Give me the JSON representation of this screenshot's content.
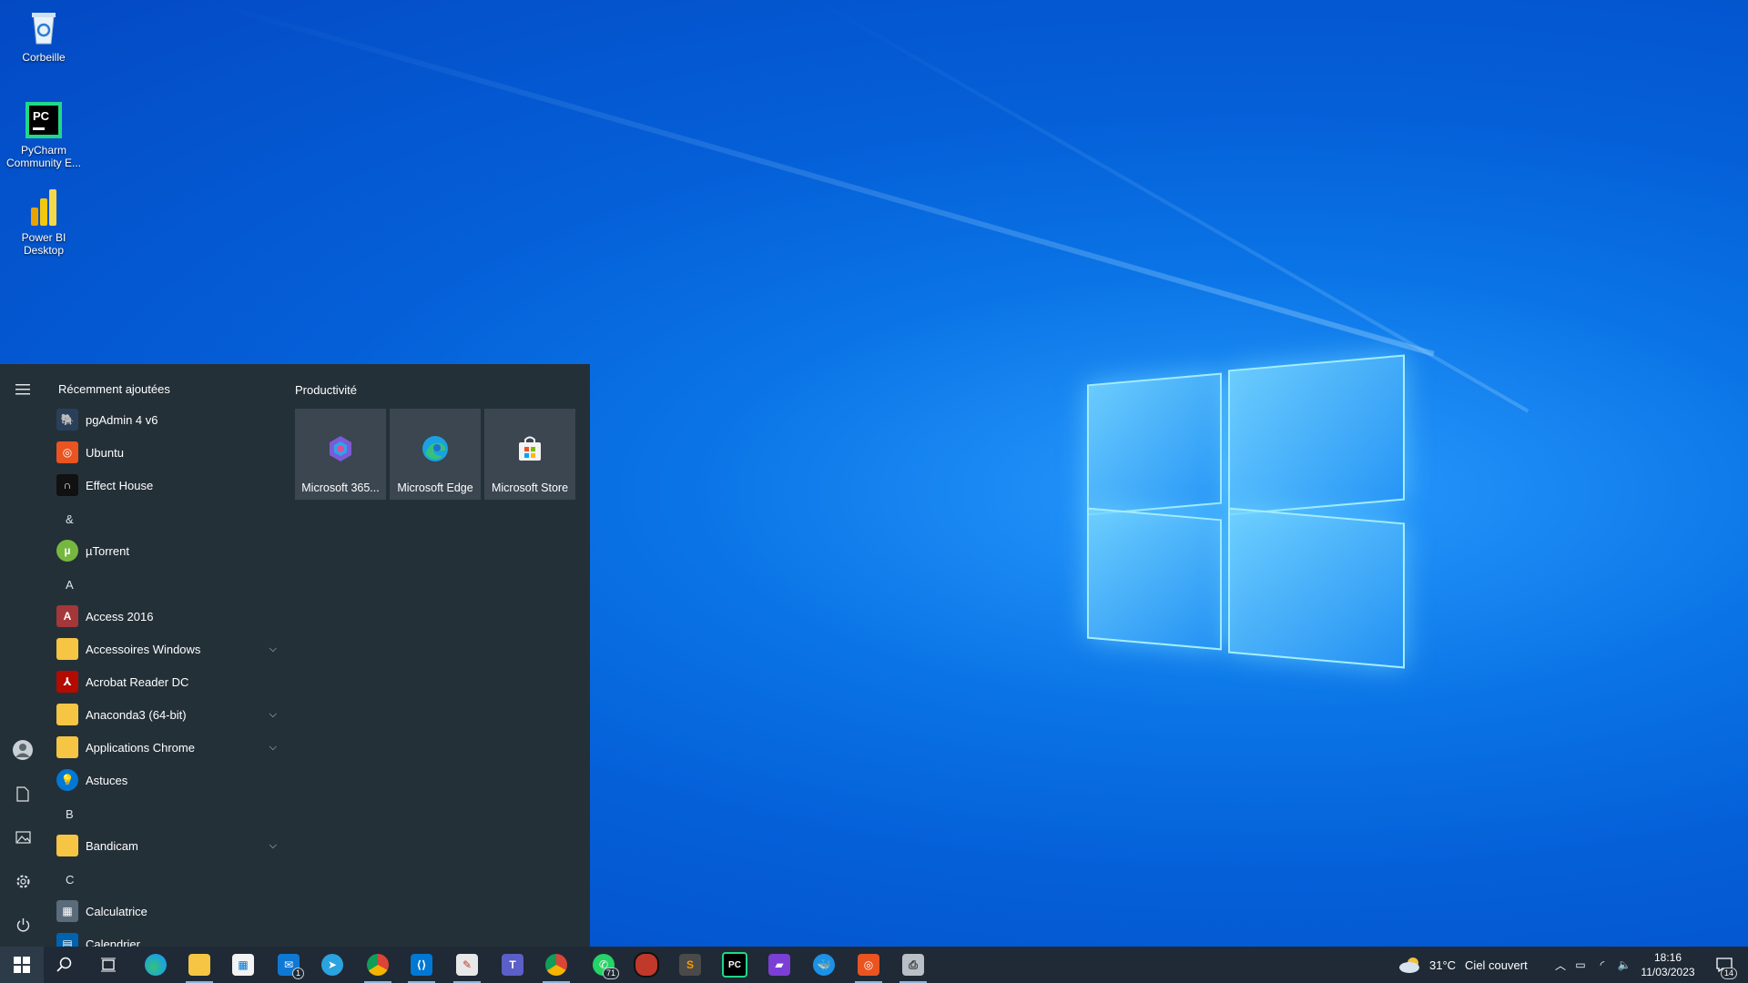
{
  "desktop": {
    "icons": [
      {
        "label": "Corbeille",
        "icon": "recycle-bin-icon"
      },
      {
        "label": "PyCharm Community E...",
        "icon": "pycharm-icon"
      },
      {
        "label": "Power BI Desktop",
        "icon": "powerbi-icon"
      }
    ]
  },
  "start_menu": {
    "rail": {
      "menu_icon": "hamburger-icon",
      "user_icon": "user-icon",
      "documents_icon": "document-icon",
      "pictures_icon": "pictures-icon",
      "settings_icon": "gear-icon",
      "power_icon": "power-icon"
    },
    "recent_header": "Récemment ajoutées",
    "recent": [
      {
        "label": "pgAdmin 4 v6",
        "icon": "pgadmin-icon"
      },
      {
        "label": "Ubuntu",
        "icon": "ubuntu-icon"
      },
      {
        "label": "Effect House",
        "icon": "effect-house-icon"
      }
    ],
    "letters": [
      "&",
      "A",
      "B",
      "C"
    ],
    "apps": [
      {
        "label": "µTorrent",
        "icon": "utorrent-icon"
      },
      {
        "label": "Access 2016",
        "icon": "access-icon"
      },
      {
        "label": "Accessoires Windows",
        "icon": "folder-icon",
        "expandable": true
      },
      {
        "label": "Acrobat Reader DC",
        "icon": "acrobat-icon"
      },
      {
        "label": "Anaconda3 (64-bit)",
        "icon": "folder-icon",
        "expandable": true
      },
      {
        "label": "Applications Chrome",
        "icon": "folder-icon",
        "expandable": true
      },
      {
        "label": "Astuces",
        "icon": "tips-icon"
      },
      {
        "label": "Bandicam",
        "icon": "folder-icon",
        "expandable": true
      },
      {
        "label": "Calculatrice",
        "icon": "calculator-icon"
      },
      {
        "label": "Calendrier",
        "icon": "calendar-icon"
      }
    ],
    "group_title": "Productivité",
    "tiles": [
      {
        "label": "Microsoft 365...",
        "icon": "microsoft365-icon"
      },
      {
        "label": "Microsoft Edge",
        "icon": "edge-icon"
      },
      {
        "label": "Microsoft Store",
        "icon": "store-icon"
      }
    ]
  },
  "taskbar": {
    "items": [
      {
        "icon": "windows-start-icon"
      },
      {
        "icon": "search-icon"
      },
      {
        "icon": "task-view-icon"
      },
      {
        "icon": "edge-icon"
      },
      {
        "icon": "file-explorer-icon"
      },
      {
        "icon": "store-icon"
      },
      {
        "icon": "mail-icon",
        "badge": "1"
      },
      {
        "icon": "telegram-icon"
      },
      {
        "icon": "chrome-icon"
      },
      {
        "icon": "vscode-icon"
      },
      {
        "icon": "paint-icon"
      },
      {
        "icon": "teams-icon"
      },
      {
        "icon": "chrome-icon"
      },
      {
        "icon": "whatsapp-icon",
        "badge": "71"
      },
      {
        "icon": "record-icon"
      },
      {
        "icon": "sublime-icon"
      },
      {
        "icon": "pycharm-icon"
      },
      {
        "icon": "clapper-icon"
      },
      {
        "icon": "docker-icon"
      },
      {
        "icon": "ubuntu-icon"
      },
      {
        "icon": "printer-icon"
      }
    ],
    "weather": {
      "icon": "cloudy-icon",
      "temp": "31°C",
      "desc": "Ciel couvert"
    },
    "time": "18:16",
    "date": "11/03/2023",
    "notifications": "14"
  },
  "colors": {
    "start_bg": "#243038",
    "tile_bg": "#3b4650",
    "taskbar_bg": "#1f2a36",
    "accent": "#0a74e6"
  }
}
